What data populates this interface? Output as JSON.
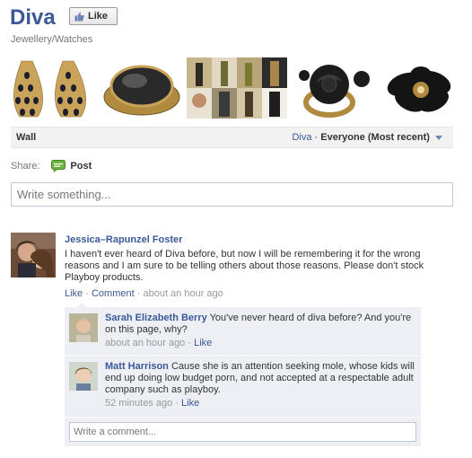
{
  "page": {
    "title": "Diva",
    "like_label": "Like",
    "category": "Jewellery/Watches"
  },
  "photos": [
    {
      "name": "earrings-photo"
    },
    {
      "name": "black-cocktail-ring-photo"
    },
    {
      "name": "fashion-collage-photo"
    },
    {
      "name": "rose-ring-photo"
    },
    {
      "name": "flower-ring-photo"
    }
  ],
  "wall": {
    "title": "Wall",
    "filter_page": "Diva",
    "filter_separator": "·",
    "filter_scope": "Everyone (Most recent)"
  },
  "share": {
    "label": "Share:",
    "post_label": "Post"
  },
  "composer": {
    "placeholder": "Write something..."
  },
  "post": {
    "author": "Jessica–Rapunzel Foster",
    "message": "I haven't ever heard of Diva before, but now I will be remembering it for the wrong reasons and I am sure to be telling others about those reasons. Please don't stock Playboy products.",
    "like_label": "Like",
    "comment_label": "Comment",
    "time": "about an hour ago",
    "sep": "·"
  },
  "comments": [
    {
      "author": "Sarah Elizabeth Berry",
      "text": "You've never heard of diva before? And you're on this page, why?",
      "time": "about an hour ago",
      "like_label": "Like",
      "sep": "·"
    },
    {
      "author": "Matt Harrison",
      "text": "Cause she is an attention seeking mole, whose kids will end up doing low budget porn, and not accepted at a respectable adult company such as playboy.",
      "time": "52 minutes ago",
      "like_label": "Like",
      "sep": "·"
    }
  ],
  "comment_box": {
    "placeholder": "Write a comment..."
  },
  "colors": {
    "link": "#3b5998",
    "comment_bg": "#edeff4",
    "muted": "#999999"
  },
  "icons": [
    "thumbs-up-icon",
    "post-icon",
    "dropdown-arrow-icon"
  ]
}
